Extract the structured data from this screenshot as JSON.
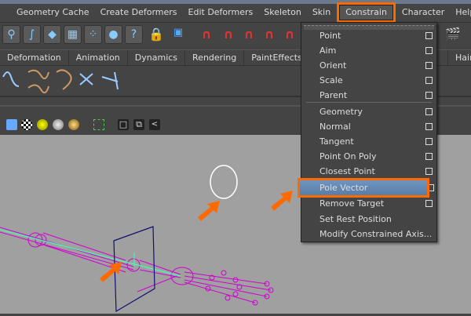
{
  "menubar": {
    "items": [
      "Geometry Cache",
      "Create Deformers",
      "Edit Deformers",
      "Skeleton",
      "Skin",
      "Constrain",
      "Character",
      "Help"
    ],
    "active": "Constrain"
  },
  "shelf_tabs": [
    "Deformation",
    "Animation",
    "Dynamics",
    "Rendering",
    "PaintEffects"
  ],
  "shelf_tab_right": "Hair",
  "constrain_menu": {
    "items": [
      {
        "label": "Point",
        "option_box": true
      },
      {
        "label": "Aim",
        "option_box": true
      },
      {
        "label": "Orient",
        "option_box": true
      },
      {
        "label": "Scale",
        "option_box": true
      },
      {
        "label": "Parent",
        "option_box": true
      },
      {
        "label": "Geometry",
        "option_box": true
      },
      {
        "label": "Normal",
        "option_box": true
      },
      {
        "label": "Tangent",
        "option_box": true
      },
      {
        "label": "Point On Poly",
        "option_box": true
      },
      {
        "label": "Closest Point",
        "option_box": true
      },
      {
        "label": "Pole Vector",
        "option_box": true,
        "highlighted": true
      },
      {
        "label": "Remove Target",
        "option_box": true
      },
      {
        "label": "Set Rest Position",
        "option_box": false
      },
      {
        "label": "Modify Constrained Axis...",
        "option_box": false
      }
    ]
  },
  "colors": {
    "highlight": "#ff6a00",
    "menu_hover": "#6287b2",
    "viewport": "#a0a0a0",
    "joint": "#d000d0"
  }
}
